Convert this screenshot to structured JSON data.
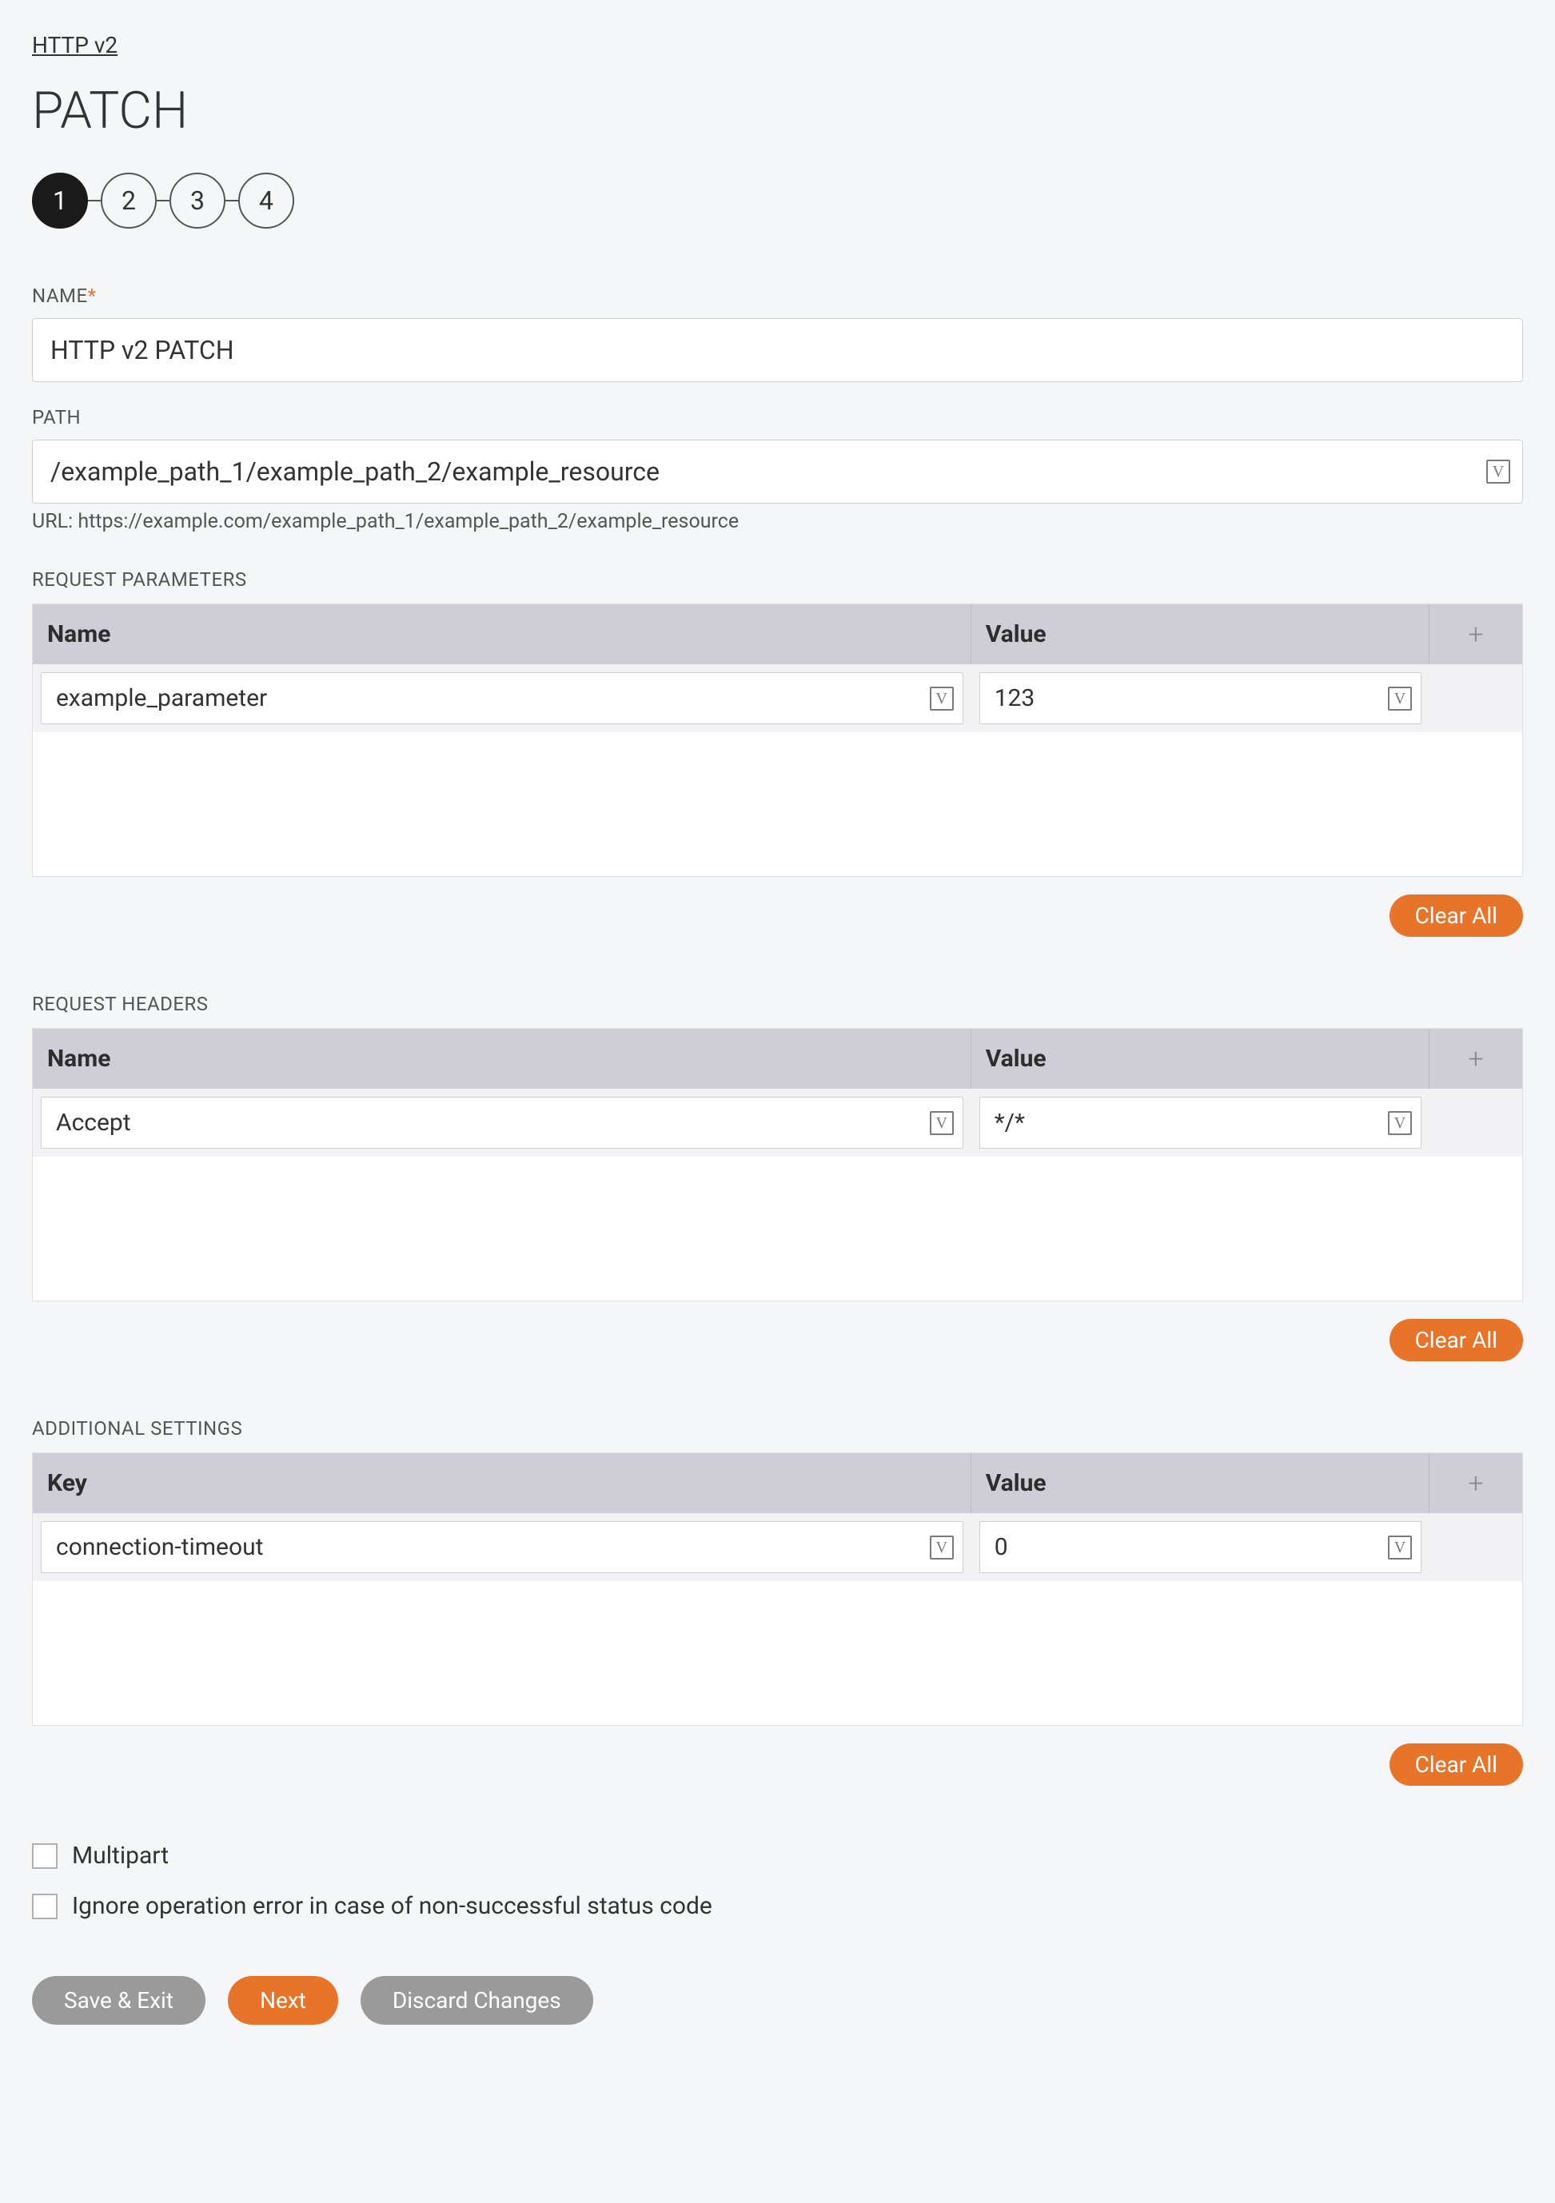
{
  "breadcrumb": {
    "label": "HTTP v2"
  },
  "title": "PATCH",
  "stepper": {
    "steps": [
      "1",
      "2",
      "3",
      "4"
    ],
    "active": 0
  },
  "fields": {
    "name": {
      "label": "NAME",
      "required_marker": "*",
      "value": "HTTP v2 PATCH"
    },
    "path": {
      "label": "PATH",
      "value": "/example_path_1/example_path_2/example_resource",
      "helper_prefix": "URL: ",
      "helper_url": "https://example.com/example_path_1/example_path_2/example_resource"
    }
  },
  "v_glyph": "V",
  "plus_glyph": "+",
  "sections": {
    "request_parameters": {
      "label": "REQUEST PARAMETERS",
      "col_name": "Name",
      "col_value": "Value",
      "row": {
        "name": "example_parameter",
        "value": "123"
      },
      "clear_label": "Clear All"
    },
    "request_headers": {
      "label": "REQUEST HEADERS",
      "col_name": "Name",
      "col_value": "Value",
      "row": {
        "name": "Accept",
        "value": "*/*"
      },
      "clear_label": "Clear All"
    },
    "additional_settings": {
      "label": "ADDITIONAL SETTINGS",
      "col_name": "Key",
      "col_value": "Value",
      "row": {
        "name": "connection-timeout",
        "value": "0"
      },
      "clear_label": "Clear All"
    }
  },
  "checkboxes": {
    "multipart": "Multipart",
    "ignore_error": "Ignore operation error in case of non-successful status code"
  },
  "buttons": {
    "save_exit": "Save & Exit",
    "next": "Next",
    "discard": "Discard Changes"
  }
}
